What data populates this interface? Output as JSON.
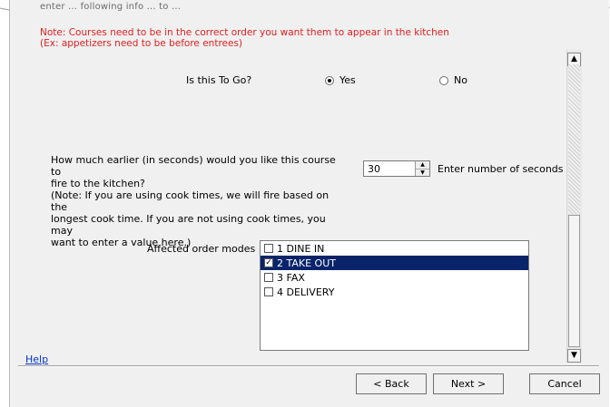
{
  "header": {
    "partial_title": "enter ... following info ... to ...",
    "note_line1": "Note: Courses need to be in the correct order you want them to appear in the kitchen",
    "note_line2": "(Ex: appetizers need to be before entrees)"
  },
  "to_go": {
    "label": "Is this To Go?",
    "yes_label": "Yes",
    "no_label": "No",
    "selected": "Yes"
  },
  "fire": {
    "line1": "How much earlier (in seconds) would you like this course to",
    "line2": "fire to the kitchen?",
    "line3": "(Note: If you are using cook times, we will fire based on the",
    "line4": "longest cook time. If you are not using cook times, you may",
    "line5": "want to enter a value here.)",
    "value": "30",
    "hint": "Enter number of seconds"
  },
  "order_modes": {
    "label": "Affected order modes",
    "items": [
      {
        "label": "1 DINE IN",
        "checked": false
      },
      {
        "label": "2 TAKE OUT",
        "checked": true
      },
      {
        "label": "3 FAX",
        "checked": false
      },
      {
        "label": "4 DELIVERY",
        "checked": false
      }
    ]
  },
  "footer": {
    "help_label": "Help",
    "back_label": "< Back",
    "next_label": "Next >",
    "cancel_label": "Cancel"
  },
  "colors": {
    "note": "#e02020",
    "selection": "#0a246a",
    "link": "#0033cc"
  }
}
